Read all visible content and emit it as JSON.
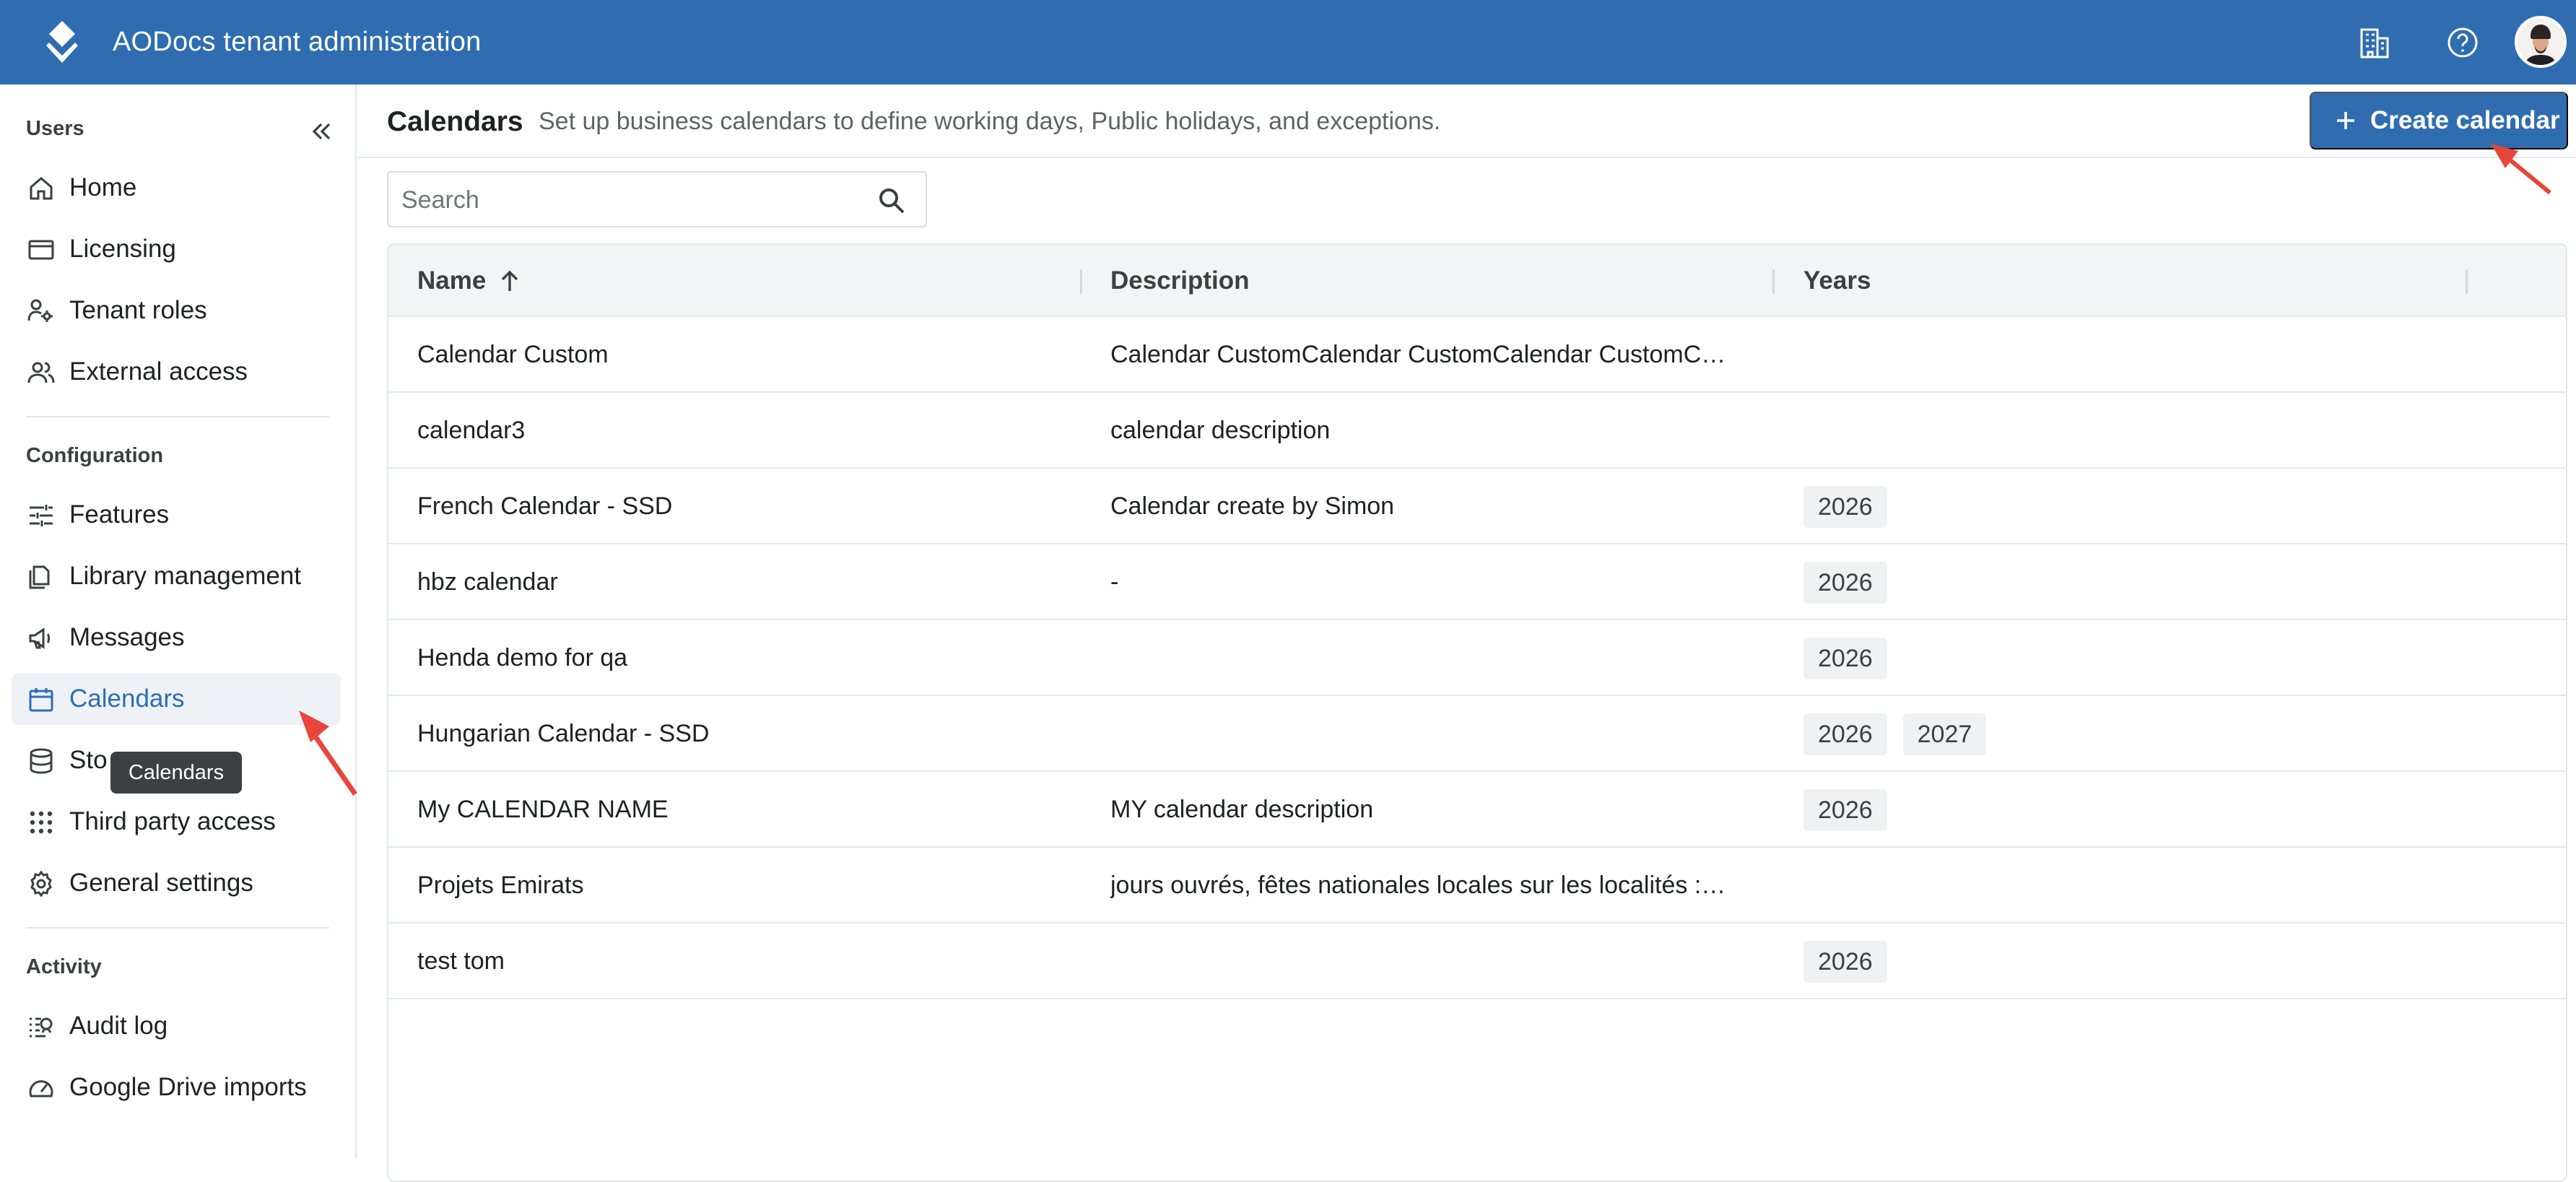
{
  "app": {
    "title": "AODocs tenant administration"
  },
  "sidebar": {
    "sections": {
      "users": "Users",
      "configuration": "Configuration",
      "activity": "Activity"
    },
    "items": [
      {
        "label": "Home"
      },
      {
        "label": "Licensing"
      },
      {
        "label": "Tenant roles"
      },
      {
        "label": "External access"
      },
      {
        "label": "Features"
      },
      {
        "label": "Library management"
      },
      {
        "label": "Messages"
      },
      {
        "label": "Calendars"
      },
      {
        "label": "Sto"
      },
      {
        "label": "Third party access"
      },
      {
        "label": "General settings"
      },
      {
        "label": "Audit log"
      },
      {
        "label": "Google Drive imports"
      }
    ],
    "tooltip": "Calendars"
  },
  "page": {
    "title": "Calendars",
    "subtitle": "Set up business calendars to define working days, Public holidays, and exceptions.",
    "create_label": "Create calendar"
  },
  "search": {
    "placeholder": "Search"
  },
  "table": {
    "columns": [
      "Name",
      "Description",
      "Years"
    ],
    "rows": [
      {
        "name": "Calendar Custom",
        "description": "Calendar CustomCalendar CustomCalendar CustomC…",
        "years": []
      },
      {
        "name": "calendar3",
        "description": "calendar description",
        "years": []
      },
      {
        "name": "French Calendar - SSD",
        "description": "Calendar create by Simon",
        "years": [
          "2026"
        ]
      },
      {
        "name": "hbz calendar",
        "description": "-",
        "years": [
          "2026"
        ]
      },
      {
        "name": "Henda demo for qa",
        "description": "",
        "years": [
          "2026"
        ]
      },
      {
        "name": "Hungarian Calendar - SSD",
        "description": "",
        "years": [
          "2026",
          "2027"
        ]
      },
      {
        "name": "My CALENDAR NAME",
        "description": "MY calendar description",
        "years": [
          "2026"
        ]
      },
      {
        "name": "Projets Emirats",
        "description": "jours ouvrés, fêtes nationales locales sur les localités :…",
        "years": []
      },
      {
        "name": "test tom",
        "description": "",
        "years": [
          "2026"
        ]
      }
    ]
  },
  "colors": {
    "brand": "#2f6db0",
    "active_bg": "#eef2f7",
    "header_bg": "#f3f4f6",
    "annotation": "#e8453c"
  }
}
